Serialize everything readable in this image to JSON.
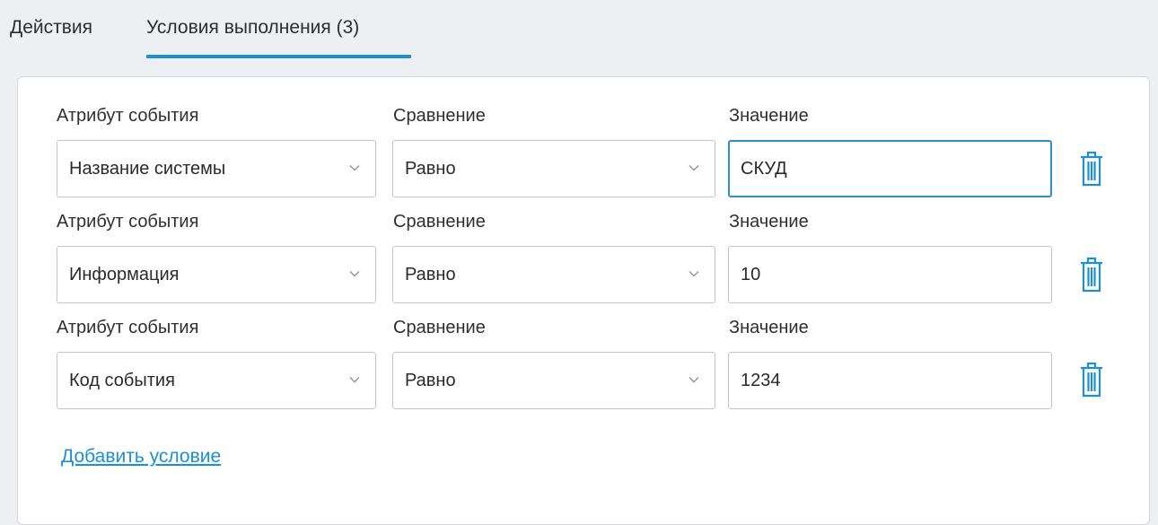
{
  "tabs": [
    {
      "label": "Действия",
      "active": false
    },
    {
      "label": "Условия выполнения (3)",
      "active": true
    }
  ],
  "conditions": [
    {
      "attribute_label": "Атрибут события",
      "comparison_label": "Сравнение",
      "value_label": "Значение",
      "attribute": "Название системы",
      "comparison": "Равно",
      "value": "СКУД"
    },
    {
      "attribute_label": "Атрибут события",
      "comparison_label": "Сравнение",
      "value_label": "Значение",
      "attribute": "Информация",
      "comparison": "Равно",
      "value": "10"
    },
    {
      "attribute_label": "Атрибут события",
      "comparison_label": "Сравнение",
      "value_label": "Значение",
      "attribute": "Код события",
      "comparison": "Равно",
      "value": "1234"
    }
  ],
  "add_condition_label": "Добавить условие",
  "icons": {
    "dropdown": "chevron-down-icon",
    "delete": "trash-icon"
  },
  "colors": {
    "accent": "#1f8fd3",
    "link": "#1b8fd6",
    "background": "#eeeff2",
    "panel": "#ffffff"
  }
}
